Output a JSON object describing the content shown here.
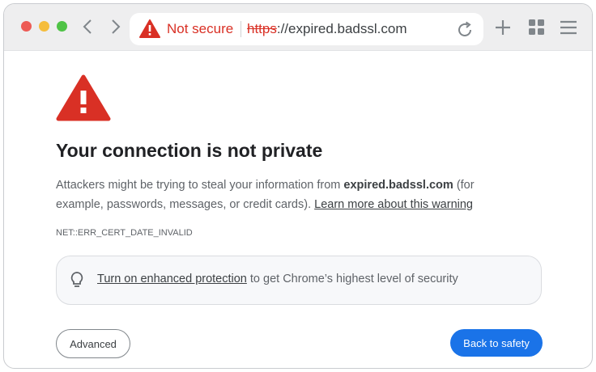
{
  "browser": {
    "security_label": "Not secure",
    "url_scheme": "https",
    "url_rest": "://expired.badssl.com",
    "colors": {
      "warning_red": "#d93025",
      "toolbar": "#eeeeef",
      "accent_blue": "#1a73e8"
    }
  },
  "page": {
    "heading": "Your connection is not private",
    "desc_prefix": "Attackers might be trying to steal your information from ",
    "desc_host": "expired.badssl.com",
    "desc_suffix": " (for example, passwords, messages, or credit cards). ",
    "learn_more_link": "Learn more about this warning",
    "error_code": "NET::ERR_CERT_DATE_INVALID",
    "enhanced_link": "Turn on enhanced protection",
    "enhanced_suffix": " to get Chrome’s highest level of security",
    "advanced_button": "Advanced",
    "back_button": "Back to safety"
  },
  "icons": [
    "warning-icon",
    "reload-icon",
    "new-tab-icon",
    "extensions-icon",
    "menu-icon",
    "lightbulb-icon",
    "back-arrow-icon",
    "forward-arrow-icon"
  ]
}
